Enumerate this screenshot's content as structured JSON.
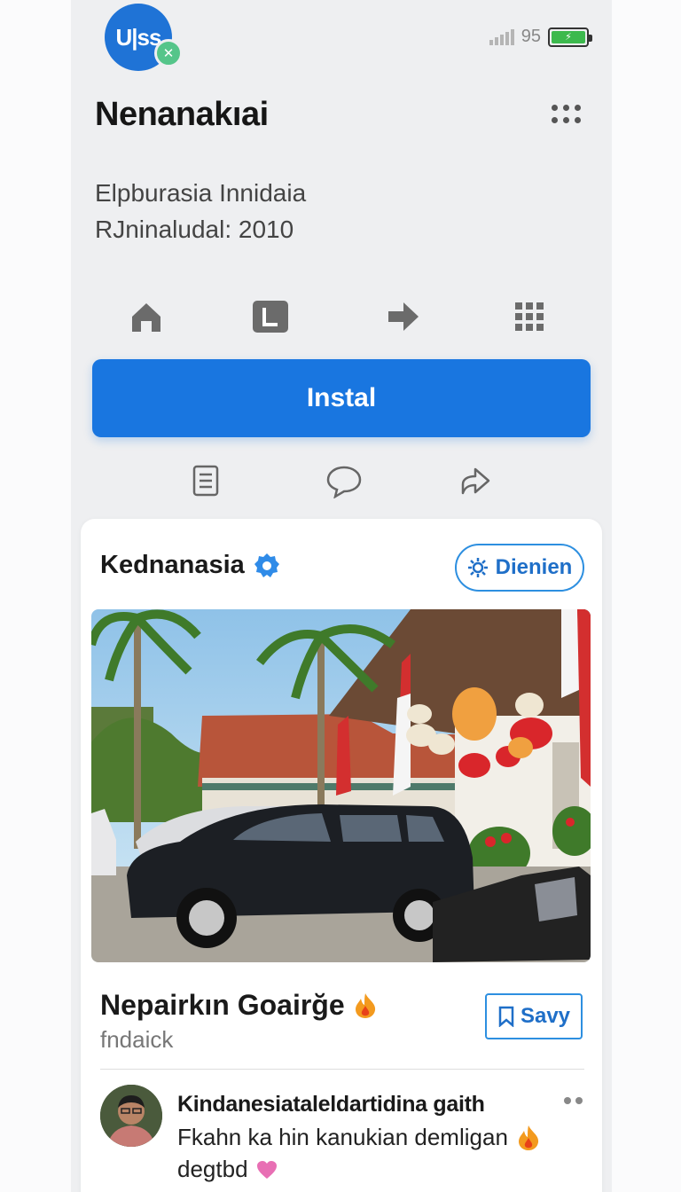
{
  "header": {
    "logo_text": "U|ss",
    "status_number": "95",
    "battery_level": 1.0,
    "app_title": "Nenanakıai",
    "meta_line_1": "Elpburasia Innidaia",
    "meta_line_2": "RJninaludal: 2010"
  },
  "nav_icons": [
    "home-icon",
    "library-icon",
    "forward-arrow-icon",
    "grid-apps-icon"
  ],
  "install_label": "Instal",
  "action_icons": [
    "document-icon",
    "comment-icon",
    "share-icon"
  ],
  "card": {
    "profile_name": "Kednanasia",
    "follow_label": "Dienien",
    "post_title": "Nepairkın Goairğe",
    "post_subtitle": "fndaick",
    "save_label": "Savy",
    "comment": {
      "author": "Kindanesiataleldartidina gaith",
      "text": "Fkahn ka hin kanukian demligan",
      "text2": "degtbd"
    }
  },
  "colors": {
    "primary": "#1976e0",
    "accent_border": "#2d8fe0",
    "background": "#eeeff1",
    "card": "#ffffff"
  }
}
